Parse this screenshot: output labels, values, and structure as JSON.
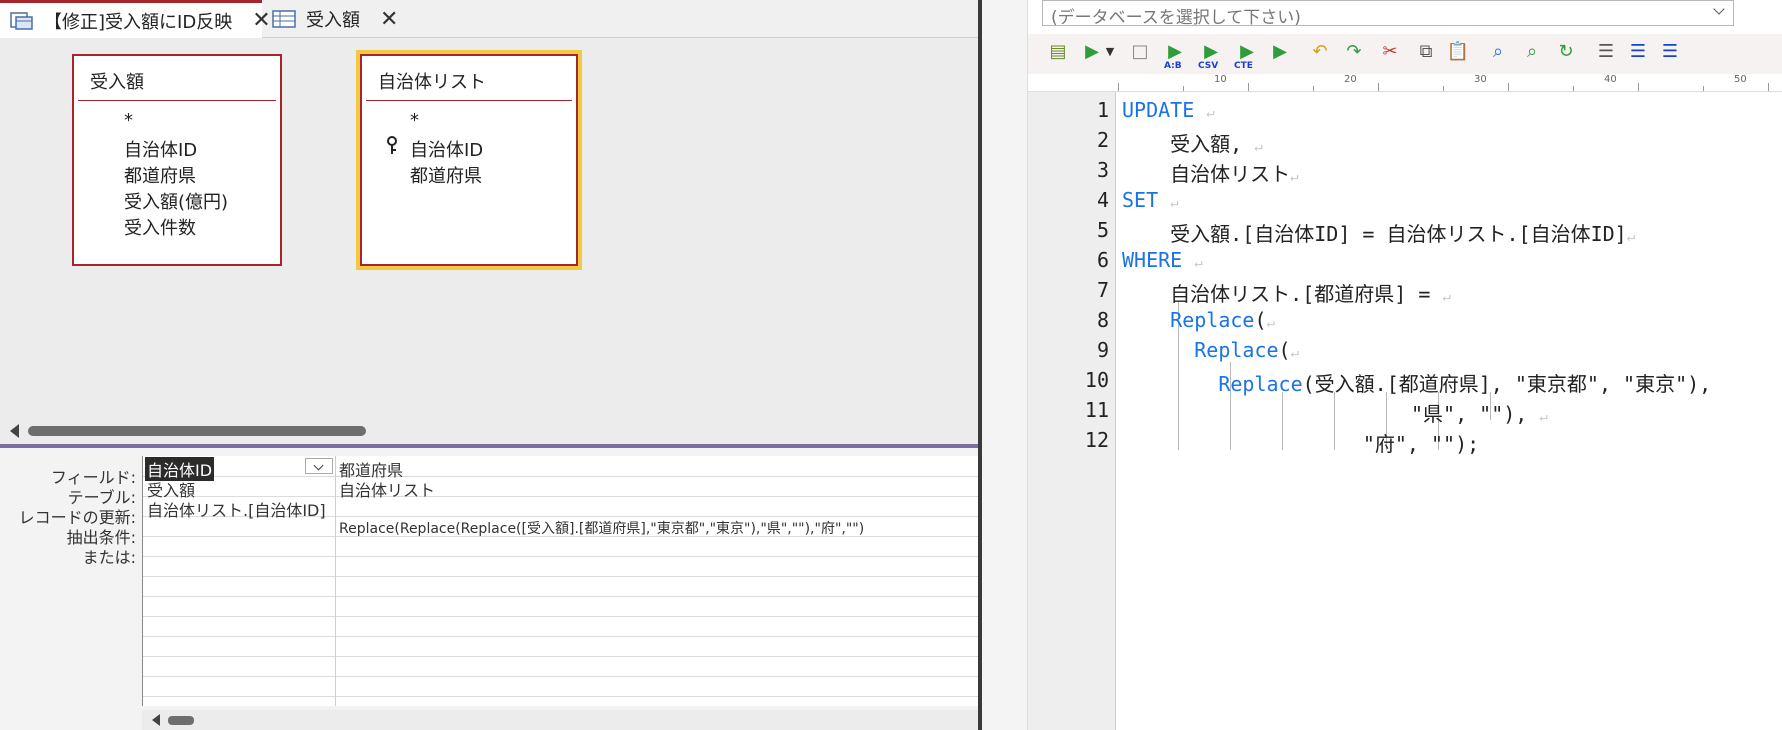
{
  "tabs": [
    {
      "label": "【修正]受入額にID反映",
      "icon": "query-icon"
    },
    {
      "label": "受入額",
      "icon": "table-icon"
    }
  ],
  "field_lists": [
    {
      "title": "受入額",
      "items": [
        "*",
        "自治体ID",
        "都道府県",
        "受入額(億円)",
        "受入件数"
      ]
    },
    {
      "title": "自治体リスト",
      "items": [
        "*",
        "自治体ID",
        "都道府県"
      ],
      "key_item": "自治体ID"
    }
  ],
  "grid": {
    "row_labels": [
      "フィールド:",
      "テーブル:",
      "レコードの更新:",
      "抽出条件:",
      "または:"
    ],
    "columns": [
      {
        "field": "自治体ID",
        "table": "受入額",
        "update_to": "自治体リスト.[自治体ID]",
        "criteria": ""
      },
      {
        "field": "都道府県",
        "table": "自治体リスト",
        "update_to": "",
        "criteria": "Replace(Replace(Replace([受入額].[都道府県],\"東京都\",\"東京\"),\"県\",\"\"),\"府\",\"\")"
      }
    ]
  },
  "editor": {
    "db_placeholder": "(データベースを選択して下さい)",
    "ruler_numbers": [
      "10",
      "20",
      "30",
      "40",
      "50"
    ],
    "line_numbers": [
      "1",
      "2",
      "3",
      "4",
      "5",
      "6",
      "7",
      "8",
      "9",
      "10",
      "11",
      "12"
    ],
    "return_mark": "↵",
    "toolbar_labels": [
      "A:B",
      "CSV",
      "CTE"
    ],
    "code": [
      {
        "kw": "UPDATE",
        "text": ""
      },
      {
        "kw": "",
        "text": "    受入額,"
      },
      {
        "kw": "",
        "text": "    自治体リスト"
      },
      {
        "kw": "SET",
        "text": ""
      },
      {
        "kw": "",
        "text": "    受入額.[自治体ID] = 自治体リスト.[自治体ID]"
      },
      {
        "kw": "WHERE",
        "text": ""
      },
      {
        "kw": "",
        "text": "    自治体リスト.[都道府県] ="
      },
      {
        "pre": "    ",
        "kw": "Replace",
        "text": "("
      },
      {
        "pre": "      ",
        "kw": "Replace",
        "text": "("
      },
      {
        "pre": "        ",
        "kw": "Replace",
        "text": "(受入額.[都道府県], \"東京都\", \"東京\"),"
      },
      {
        "kw": "",
        "text": "                        \"県\", \"\"),"
      },
      {
        "kw": "",
        "text": "                    \"府\", \"\");"
      }
    ]
  },
  "colors": {
    "accent": "#a4262c",
    "keyword": "#1a73e8",
    "selection": "#f5c842"
  }
}
